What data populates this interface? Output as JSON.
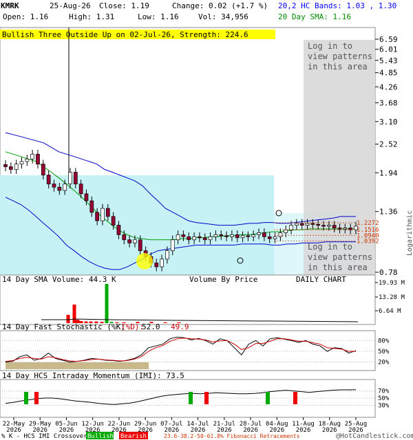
{
  "header": {
    "symbol": "KMRK",
    "date": "25-Aug-26",
    "close": "Close: 1.19",
    "change": "Change: 0.02 (+1.7 %)",
    "open": "Open: 1.16",
    "high": "High: 1.31",
    "low": "Low: 1.16",
    "vol": "Vol: 34,956",
    "bands": "20,2 HC Bands: 1.03 , 1.30",
    "sma": "20 Day SMA: 1.16"
  },
  "pattern_banner": "Bullish Three Outside Up on 02-Jul-26, Strength: 224.6",
  "login_notice": [
    "Log in to",
    "view patterns",
    "in this area"
  ],
  "chart_data": [
    {
      "type": "candlestick",
      "scale": "logarithmic",
      "yticks": [
        "6.59",
        "6.01",
        "5.43",
        "4.85",
        "4.26",
        "3.68",
        "3.10",
        "2.52",
        "1.94",
        "1.36",
        "0.78"
      ],
      "ylabel": "Logarithmic",
      "levels": [
        "1.2272",
        "1.1516",
        "1.0940",
        "1.0392"
      ],
      "annotations": [
        "Volume By Price",
        "DAILY CHART"
      ],
      "close_values": [
        2.05,
        2.0,
        2.1,
        2.15,
        2.2,
        2.3,
        2.1,
        1.9,
        1.75,
        1.7,
        1.65,
        1.75,
        1.95,
        1.75,
        1.6,
        1.5,
        1.35,
        1.25,
        1.4,
        1.3,
        1.2,
        1.1,
        1.05,
        1.02,
        1.05,
        0.95,
        0.9,
        0.85,
        0.82,
        0.88,
        0.95,
        1.05,
        1.1,
        1.08,
        1.05,
        1.08,
        1.07,
        1.05,
        1.08,
        1.1,
        1.09,
        1.08,
        1.1,
        1.07,
        1.09,
        1.08,
        1.1,
        1.12,
        1.08,
        1.06,
        1.08,
        1.12,
        1.15,
        1.2,
        1.22,
        1.2,
        1.22,
        1.21,
        1.2,
        1.19,
        1.2,
        1.17,
        1.16,
        1.17,
        1.15,
        1.19
      ],
      "upper_band": [
        2.8,
        2.75,
        2.7,
        2.65,
        2.6,
        2.55,
        2.45,
        2.35,
        2.3,
        2.25,
        2.2,
        2.15,
        2.1,
        2.0,
        1.95,
        1.9,
        1.85,
        1.8,
        1.72,
        1.6,
        1.5,
        1.4,
        1.35,
        1.3,
        1.25,
        1.23,
        1.22,
        1.21,
        1.2,
        1.2,
        1.2,
        1.21,
        1.22,
        1.22,
        1.23,
        1.23,
        1.22,
        1.22,
        1.23,
        1.24,
        1.25,
        1.26,
        1.27,
        1.28,
        1.3,
        1.3,
        1.3
      ],
      "lower_band": [
        1.55,
        1.5,
        1.45,
        1.38,
        1.3,
        1.22,
        1.15,
        1.08,
        1.0,
        0.95,
        0.9,
        0.86,
        0.83,
        0.81,
        0.8,
        0.8,
        0.82,
        0.85,
        0.88,
        0.92,
        0.95,
        0.96,
        0.97,
        0.98,
        0.99,
        1.0,
        1.0,
        1.0,
        1.0,
        1.0,
        1.0,
        1.01,
        1.01,
        1.01,
        1.01,
        1.0,
        1.0,
        1.01,
        1.01,
        1.02,
        1.02,
        1.02,
        1.03,
        1.03,
        1.03,
        1.03,
        1.03
      ],
      "sma20": [
        2.35,
        2.3,
        2.25,
        2.2,
        2.15,
        2.05,
        1.95,
        1.85,
        1.75,
        1.65,
        1.55,
        1.45,
        1.35,
        1.27,
        1.2,
        1.14,
        1.1,
        1.07,
        1.06,
        1.05,
        1.05,
        1.05,
        1.05,
        1.06,
        1.06,
        1.07,
        1.07,
        1.08,
        1.08,
        1.09,
        1.09,
        1.1,
        1.1,
        1.11,
        1.12,
        1.13,
        1.13,
        1.14,
        1.15,
        1.15,
        1.16,
        1.16,
        1.16,
        1.16,
        1.16,
        1.16,
        1.16
      ]
    },
    {
      "type": "bar",
      "title": "14 Day SMA Volume: 44.3 K",
      "yticks": [
        "19.93 M",
        "13.28 M",
        "6.64 M"
      ]
    },
    {
      "type": "line",
      "title": "14 Day Fast Stochastic (%K)",
      "k_label": "52.0",
      "d_label": "(%D):",
      "d_value": "49.9",
      "yticks": [
        "80%",
        "50%",
        "20%"
      ],
      "k_values": [
        20,
        22,
        35,
        40,
        25,
        30,
        45,
        30,
        25,
        20,
        22,
        25,
        30,
        28,
        25,
        24,
        22,
        25,
        30,
        40,
        60,
        65,
        70,
        85,
        90,
        88,
        82,
        86,
        80,
        70,
        85,
        80,
        60,
        40,
        70,
        80,
        65,
        85,
        88,
        84,
        80,
        75,
        80,
        70,
        65,
        50,
        60,
        58,
        45,
        52
      ],
      "d_values": [
        22,
        24,
        30,
        33,
        30,
        28,
        35,
        32,
        27,
        23,
        22,
        24,
        27,
        28,
        26,
        25,
        23,
        24,
        28,
        35,
        50,
        60,
        66,
        78,
        85,
        87,
        85,
        84,
        82,
        76,
        79,
        80,
        70,
        55,
        60,
        72,
        72,
        78,
        85,
        85,
        82,
        78,
        78,
        74,
        70,
        60,
        58,
        56,
        50,
        50
      ]
    },
    {
      "type": "line",
      "title": "14 Day HCS Intraday Momentum (IMI): 73.5",
      "yticks": [
        "70%",
        "50%",
        "30%"
      ],
      "values": [
        35,
        38,
        42,
        45,
        48,
        50,
        50,
        48,
        45,
        42,
        40,
        38,
        35,
        33,
        32,
        34,
        36,
        40,
        45,
        50,
        55,
        58,
        60,
        62,
        63,
        62,
        63,
        65,
        64,
        63,
        62,
        62,
        63,
        65,
        68,
        70,
        72,
        70,
        68,
        66,
        68,
        70,
        72,
        73,
        73,
        73.5
      ]
    }
  ],
  "x_axis": {
    "dates": [
      "22-May",
      "29-May",
      "05-Jun",
      "12-Jun",
      "22-Jun",
      "29-Jun",
      "07-Jul",
      "14-Jul",
      "21-Jul",
      "28-Jul",
      "04-Aug",
      "11-Aug",
      "18-Aug",
      "25-Aug"
    ],
    "year": "2026"
  },
  "footer": {
    "prefix": "% K - HCS IMI Crossover:",
    "bullish": "Bullish",
    "bearish": "Bearish",
    "fib": "23.6-38.2-50-61.8% Fibonacci Retracements",
    "copyright": "@HotCandlestick.com"
  },
  "colors": {
    "band": "#0000cc",
    "sma": "#009900",
    "up": "#ffffff",
    "down": "#990033",
    "volume_bg": "#c6f2f6",
    "banner": "#ffff00",
    "bullish": "#00aa00",
    "bearish": "#ee0000",
    "fib": "#cc3300"
  }
}
